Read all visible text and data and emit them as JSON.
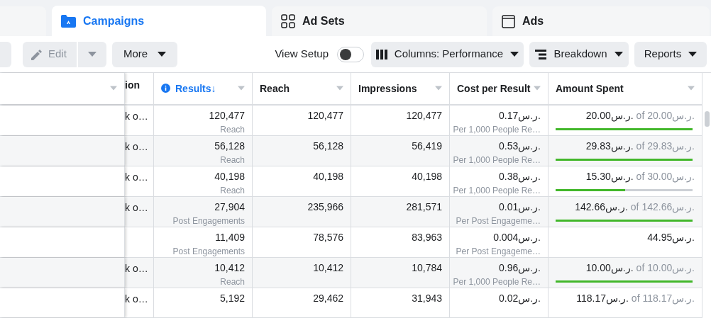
{
  "tabs": [
    {
      "label": "Campaigns",
      "selected": true
    },
    {
      "label": "Ad Sets",
      "selected": false
    },
    {
      "label": "Ads",
      "selected": false
    }
  ],
  "toolbar": {
    "left": [
      {
        "kind": "edit",
        "label": "Edit",
        "disabled": true
      },
      {
        "kind": "caret",
        "disabled": true
      },
      {
        "kind": "menu",
        "label": "More",
        "disabled": false
      }
    ],
    "view_setup": {
      "label": "View Setup",
      "on": false
    },
    "right": [
      {
        "kind": "columns",
        "label": "Columns: Performance"
      },
      {
        "kind": "breakdown",
        "label": "Breakdown"
      },
      {
        "kind": "plain",
        "label": "Reports"
      }
    ]
  },
  "table": {
    "columns": [
      {},
      {
        "label": "ion"
      },
      {
        "label": "Results",
        "sort": "↓",
        "active": true
      },
      {
        "label": "Reach",
        "active": false
      },
      {
        "label": "Impressions",
        "active": false
      },
      {
        "label": "Cost per Result",
        "active": false
      },
      {
        "label": "Amount Spent",
        "active": false
      }
    ],
    "rows": [
      {
        "column_2": "k o…",
        "results": "120,477",
        "result_type": "Reach",
        "reach": "120,477",
        "impressions": "120,477",
        "cost": "0.17ر.س.",
        "cost_type": "Per 1,000 People Re…",
        "spent": "20.00ر.س.",
        "budget": "of 20.00ر.س.",
        "level": 1
      },
      {
        "column_2": "k o…",
        "results": "56,128",
        "result_type": "Reach",
        "reach": "56,128",
        "impressions": "56,419",
        "cost": "0.53ر.س.",
        "cost_type": "Per 1,000 People Re…",
        "spent": "29.83ر.س.",
        "budget": "of 29.83ر.س.",
        "level": 1
      },
      {
        "column_2": "k o…",
        "results": "40,198",
        "result_type": "Reach",
        "reach": "40,198",
        "impressions": "40,198",
        "cost": "0.38ر.س.",
        "cost_type": "Per 1,000 People Re…",
        "spent": "15.30ر.س.",
        "budget": "of 30.00ر.س.",
        "level": 0.51
      },
      {
        "column_2": "k o…",
        "results": "27,904",
        "result_type": "Post Engagements",
        "reach": "235,966",
        "impressions": "281,571",
        "cost": "0.01ر.س.",
        "cost_type": "Per Post Engageme…",
        "spent": "142.66ر.س.",
        "budget": "of 142.66ر.س.",
        "level": 1
      },
      {
        "results": "11,409",
        "result_type": "Post Engagements",
        "reach": "78,576",
        "impressions": "83,963",
        "cost": "0.004ر.س.",
        "cost_type": "Per Post Engageme…",
        "total_spent": "44.95ر.س."
      },
      {
        "column_2": "k o…",
        "results": "10,412",
        "result_type": "Reach",
        "reach": "10,412",
        "impressions": "10,784",
        "cost": "0.96ر.س.",
        "cost_type": "Per 1,000 People Re…",
        "spent": "10.00ر.س.",
        "budget": "of 10.00ر.س.",
        "level": 1
      },
      {
        "column_2": "k o…",
        "results": "5,192",
        "reach": "29,462",
        "impressions": "31,943",
        "cost": "0.02ر.س.",
        "spent": "118.17ر.س.",
        "budget": "of 118.17ر.س."
      }
    ]
  }
}
